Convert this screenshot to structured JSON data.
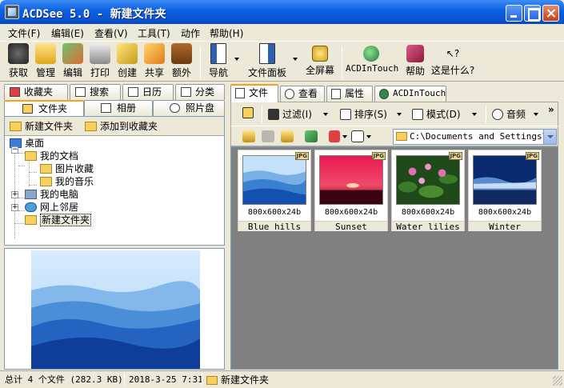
{
  "window": {
    "title": "ACDSee 5.0 - 新建文件夹"
  },
  "menu": [
    "文件(F)",
    "编辑(E)",
    "查看(V)",
    "工具(T)",
    "动作",
    "帮助(H)"
  ],
  "toolbar": {
    "buttons": [
      "获取",
      "管理",
      "编辑",
      "打印",
      "创建",
      "共享",
      "额外",
      "导航",
      "文件面板",
      "全屏幕",
      "ACDInTouch",
      "帮助",
      "这是什么?"
    ]
  },
  "left_tabs": {
    "row1": [
      "收藏夹",
      "搜索",
      "日历",
      "分类"
    ],
    "row2": [
      "文件夹",
      "相册",
      "照片盘"
    ]
  },
  "tree_header": {
    "new_folder": "新建文件夹",
    "add_favorite": "添加到收藏夹"
  },
  "tree": [
    "桌面",
    "我的文档",
    "图片收藏",
    "我的音乐",
    "我的电脑",
    "网上邻居",
    "新建文件夹"
  ],
  "right_tabs": [
    "文件",
    "查看",
    "属性",
    "ACDInTouch"
  ],
  "subtoolbar": {
    "filter": "过滤(I)",
    "sort": "排序(S)",
    "mode": "模式(D)",
    "audio": "音频",
    "more": "»"
  },
  "nav": {
    "path": "C:\\Documents and Settings\\sx"
  },
  "files": [
    {
      "name": "Blue hills",
      "info": "800x600x24b",
      "badge": "JPG"
    },
    {
      "name": "Sunset",
      "info": "800x600x24b",
      "badge": "JPG"
    },
    {
      "name": "Water lilies",
      "info": "800x600x24b",
      "badge": "JPG"
    },
    {
      "name": "Winter",
      "info": "800x600x24b",
      "badge": "JPG"
    }
  ],
  "status": {
    "total": "总计 4 个文件 (282.3 KB)",
    "date": "2018-3-25 7:31",
    "folder": "新建文件夹"
  },
  "colors": {
    "title_blue": "#0a5fe0",
    "window_bg": "#ece9d8",
    "file_list_bg": "#808080",
    "tab_accent": "#f6a21a"
  }
}
